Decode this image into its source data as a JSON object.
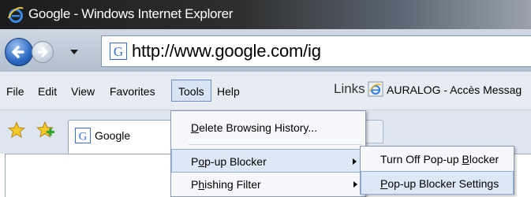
{
  "window": {
    "title": "Google - Windows Internet Explorer"
  },
  "address_bar": {
    "url": "http://www.google.com/ig"
  },
  "menubar": {
    "items": [
      "File",
      "Edit",
      "View",
      "Favorites",
      "Tools",
      "Help"
    ],
    "active": "Tools"
  },
  "links_bar": {
    "label": "Links",
    "link": "AURALOG - Accès Messag"
  },
  "tabs": [
    {
      "label": "Google"
    }
  ],
  "tools_menu": {
    "items": [
      {
        "label": "Delete Browsing History...",
        "underline": "D",
        "rest": "elete Browsing History..."
      },
      {
        "label": "Pop-up Blocker",
        "pre": "P",
        "underline": "o",
        "rest": "p-up Blocker",
        "submenu": true
      },
      {
        "label": "Phishing Filter",
        "pre": "P",
        "underline": "h",
        "rest": "ishing Filter",
        "submenu": true
      }
    ]
  },
  "popup_submenu": {
    "items": [
      {
        "label": "Turn Off Pop-up Blocker",
        "pre": "Turn Off Pop-up ",
        "underline": "B",
        "rest": "locker"
      },
      {
        "label": "Pop-up Blocker Settings",
        "pre": "",
        "underline": "P",
        "rest": "op-up Blocker Settings"
      }
    ]
  },
  "colors": {
    "accent": "#2a67c1",
    "highlight": "#dce8f7"
  }
}
